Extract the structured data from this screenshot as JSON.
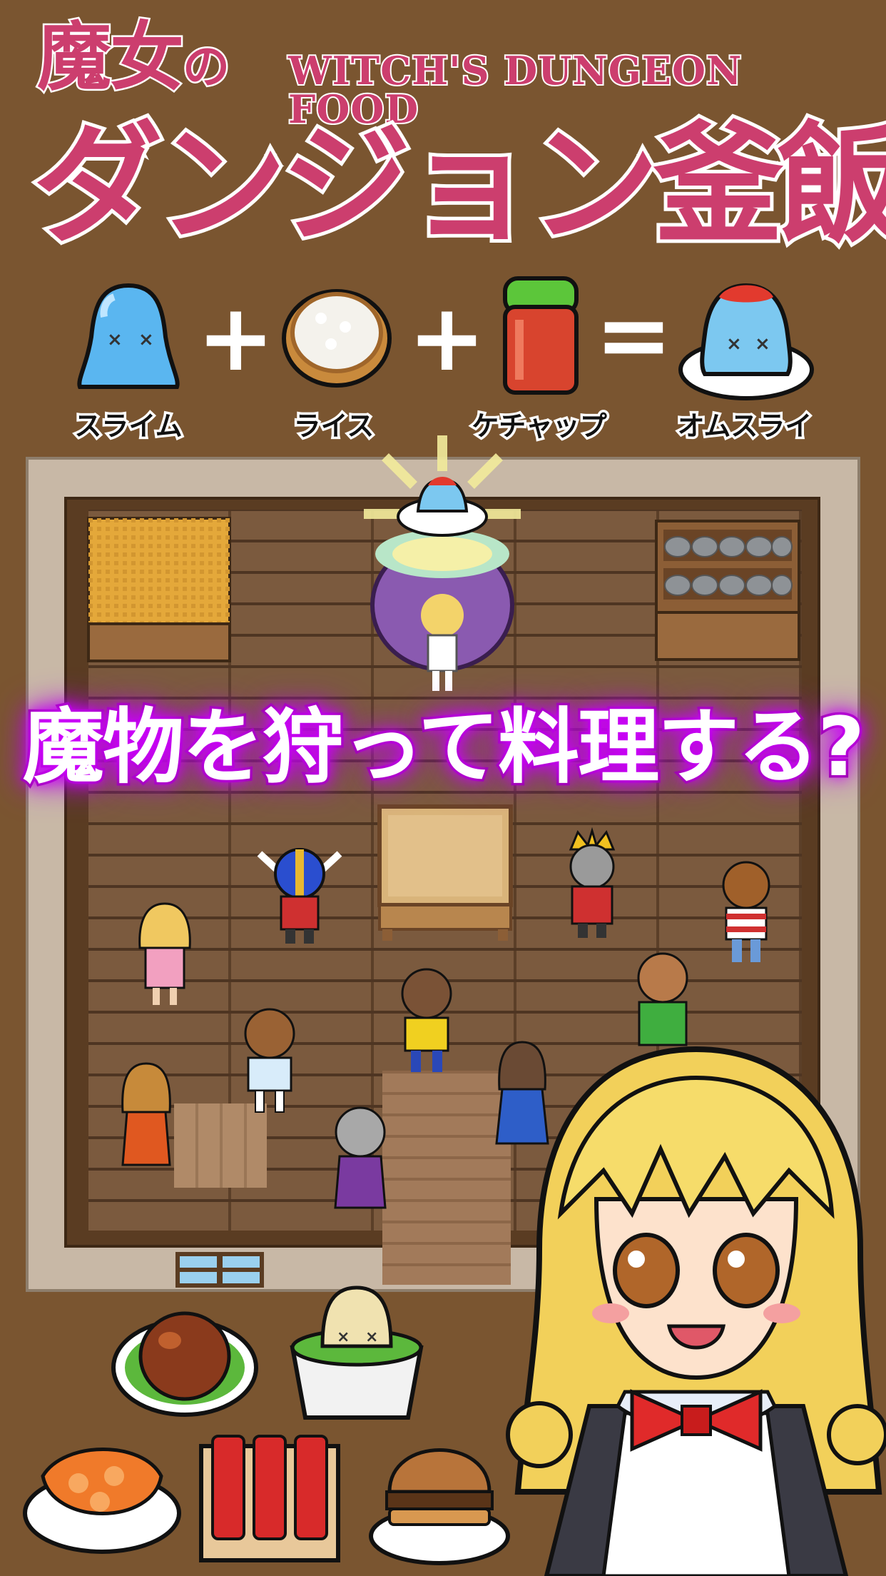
{
  "title": {
    "line1": "魔女",
    "line1_particle": "の",
    "english": "WITCH'S DUNGEON FOOD",
    "main": "ダンジョン釜飯"
  },
  "recipe": {
    "items": [
      {
        "label": "スライム",
        "icon": "slime-icon"
      },
      {
        "label": "ライス",
        "icon": "rice-bowl-icon"
      },
      {
        "label": "ケチャップ",
        "icon": "ketchup-jar-icon"
      },
      {
        "label": "オムスライ",
        "icon": "omuslime-dish-icon"
      }
    ],
    "operators": [
      "+",
      "+",
      "="
    ]
  },
  "banner": "魔物を狩って料理する?",
  "colors": {
    "background": "#7a5530",
    "title_pink": "#cc3e6e",
    "banner_glow": "#c000f0",
    "floor": "#7b5a3e"
  },
  "characters": [
    "witch-cauldron",
    "viking-hero",
    "king",
    "blonde-girl",
    "striped-boy",
    "green-boy",
    "yellow-boy",
    "blue-girl",
    "orange-girl",
    "white-shirt-boy",
    "gray-granny",
    "witch-girl-portrait"
  ],
  "dishes": [
    "roast-chicken-icon",
    "slime-rice-bowl-icon",
    "shrimp-platter-icon",
    "meat-box-icon",
    "burger-icon"
  ]
}
